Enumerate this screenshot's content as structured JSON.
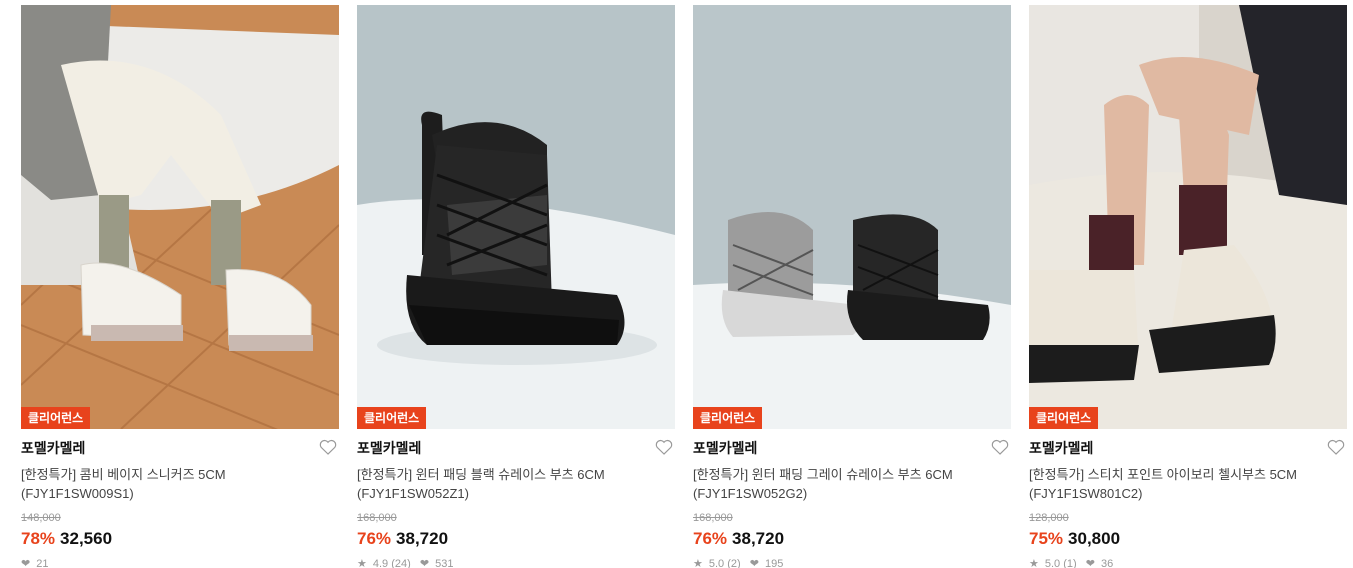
{
  "products": [
    {
      "badge": "클리어런스",
      "brand": "포멜카멜레",
      "name": "[한정특가] 콤비 베이지 스니커즈 5CM (FJY1F1SW009S1)",
      "original_price": "148,000",
      "discount": "78%",
      "price": "32,560",
      "rating": "",
      "likes": "21"
    },
    {
      "badge": "클리어런스",
      "brand": "포멜카멜레",
      "name": "[한정특가] 윈터 패딩 블랙 슈레이스 부츠 6CM (FJY1F1SW052Z1)",
      "original_price": "168,000",
      "discount": "76%",
      "price": "38,720",
      "rating": "4.9 (24)",
      "likes": "531"
    },
    {
      "badge": "클리어런스",
      "brand": "포멜카멜레",
      "name": "[한정특가] 윈터 패딩 그레이 슈레이스 부츠 6CM (FJY1F1SW052G2)",
      "original_price": "168,000",
      "discount": "76%",
      "price": "38,720",
      "rating": "5.0 (2)",
      "likes": "195"
    },
    {
      "badge": "클리어런스",
      "brand": "포멜카멜레",
      "name": "[한정특가] 스티치 포인트 아이보리 첼시부츠 5CM (FJY1F1SW801C2)",
      "original_price": "128,000",
      "discount": "75%",
      "price": "30,800",
      "rating": "5.0 (1)",
      "likes": "36"
    }
  ],
  "colors": {
    "accent": "#e8431c",
    "muted": "#999999"
  },
  "icons": {
    "wishlist": "heart-outline-icon",
    "rating": "star-icon",
    "likes": "heart-filled-icon"
  }
}
